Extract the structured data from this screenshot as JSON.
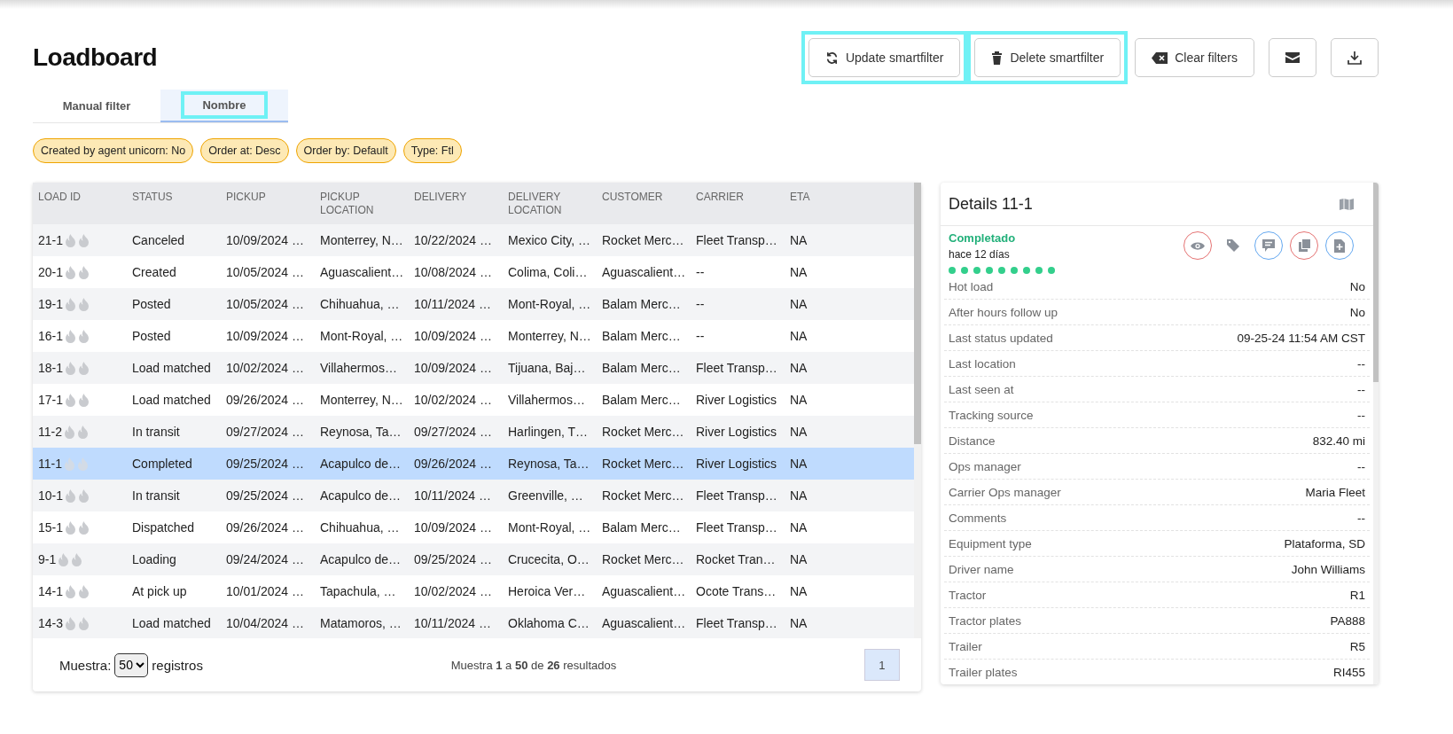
{
  "page": {
    "title": "Loadboard"
  },
  "toolbar": [
    {
      "label": "Update smartfilter",
      "highlighted": true
    },
    {
      "label": "Delete smartfilter",
      "highlighted": true
    },
    {
      "label": "Clear filters",
      "highlighted": false
    },
    {
      "highlighted": false
    },
    {
      "highlighted": false
    }
  ],
  "tabs": [
    {
      "label": "Manual filter",
      "selected": false,
      "highlighted": false
    },
    {
      "label": "Nombre",
      "selected": true,
      "highlighted": true
    }
  ],
  "filter_chips": [
    "Created by agent unicorn: No",
    "Order at: Desc",
    "Order by: Default",
    "Type: Ftl"
  ],
  "table": {
    "columns": [
      "LOAD ID",
      "STATUS",
      "PICKUP",
      "PICKUP LOCATION",
      "DELIVERY",
      "DELIVERY LOCATION",
      "CUSTOMER",
      "CARRIER",
      "ETA"
    ],
    "rows": [
      {
        "selected": false,
        "cells": [
          "21-1",
          "Canceled",
          "10/09/2024 …",
          "Monterrey, N…",
          "10/22/2024 …",
          "Mexico City, …",
          "Rocket Merc…",
          "Fleet Transp…",
          "NA"
        ]
      },
      {
        "selected": false,
        "cells": [
          "20-1",
          "Created",
          "10/05/2024 …",
          "Aguascalient…",
          "10/08/2024 …",
          "Colima, Coli…",
          "Aguascalient…",
          "--",
          "NA"
        ]
      },
      {
        "selected": false,
        "cells": [
          "19-1",
          "Posted",
          "10/05/2024 …",
          "Chihuahua, …",
          "10/11/2024 …",
          "Mont-Royal, …",
          "Balam Merc…",
          "--",
          "NA"
        ]
      },
      {
        "selected": false,
        "cells": [
          "16-1",
          "Posted",
          "10/09/2024 …",
          "Mont-Royal, …",
          "10/09/2024 …",
          "Monterrey, N…",
          "Balam Merc…",
          "--",
          "NA"
        ]
      },
      {
        "selected": false,
        "cells": [
          "18-1",
          "Load matched",
          "10/02/2024 …",
          "Villahermos…",
          "10/09/2024 …",
          "Tijuana, Baj…",
          "Balam Merc…",
          "Fleet Transp…",
          "NA"
        ]
      },
      {
        "selected": false,
        "cells": [
          "17-1",
          "Load matched",
          "09/26/2024 …",
          "Monterrey, N…",
          "10/02/2024 …",
          "Villahermos…",
          "Balam Merc…",
          "River Logistics",
          "NA"
        ]
      },
      {
        "selected": false,
        "cells": [
          "11-2",
          "In transit",
          "09/27/2024 …",
          "Reynosa, Ta…",
          "09/27/2024 …",
          "Harlingen, T…",
          "Rocket Merc…",
          "River Logistics",
          "NA"
        ]
      },
      {
        "selected": true,
        "cells": [
          "11-1",
          "Completed",
          "09/25/2024 …",
          "Acapulco de…",
          "09/26/2024 …",
          "Reynosa, Ta…",
          "Rocket Merc…",
          "River Logistics",
          "NA"
        ]
      },
      {
        "selected": false,
        "cells": [
          "10-1",
          "In transit",
          "09/25/2024 …",
          "Acapulco de…",
          "10/11/2024 …",
          "Greenville, …",
          "Rocket Merc…",
          "Fleet Transp…",
          "NA"
        ]
      },
      {
        "selected": false,
        "cells": [
          "15-1",
          "Dispatched",
          "09/26/2024 …",
          "Chihuahua, …",
          "10/09/2024 …",
          "Mont-Royal, …",
          "Balam Merc…",
          "Fleet Transp…",
          "NA"
        ]
      },
      {
        "selected": false,
        "cells": [
          "9-1",
          "Loading",
          "09/24/2024 …",
          "Acapulco de…",
          "09/25/2024 …",
          "Crucecita, O…",
          "Rocket Merc…",
          "Rocket Tran…",
          "NA"
        ]
      },
      {
        "selected": false,
        "cells": [
          "14-1",
          "At pick up",
          "10/01/2024 …",
          "Tapachula, …",
          "10/02/2024 …",
          "Heroica Ver…",
          "Aguascalient…",
          "Ocote Trans…",
          "NA"
        ]
      },
      {
        "selected": false,
        "cells": [
          "14-3",
          "Load matched",
          "10/04/2024 …",
          "Matamoros, …",
          "10/11/2024 …",
          "Oklahoma C…",
          "Aguascalient…",
          "Fleet Transp…",
          "NA"
        ]
      }
    ],
    "footer": {
      "show_label": "Muestra:",
      "page_size": "50",
      "records_label": "registros",
      "summary": "Muestra **1** a **50** de **26** resultados",
      "pages": [
        {
          "label": "1",
          "selected": true
        }
      ]
    }
  },
  "details": {
    "title": "Details 11-1",
    "status": "Completado",
    "age": "hace 12 días",
    "steps": [
      {
        "done": true
      },
      {
        "done": true
      },
      {
        "done": true
      },
      {
        "done": true
      },
      {
        "done": true
      },
      {
        "done": true
      },
      {
        "done": true
      },
      {
        "done": true
      },
      {
        "done": true
      }
    ],
    "actions": [
      {
        "kind": "ring",
        "color": "#e57373"
      },
      {
        "kind": "plain"
      },
      {
        "kind": "ring",
        "color": "#64a8f0"
      },
      {
        "kind": "ring",
        "color": "#e57373"
      },
      {
        "kind": "ring",
        "color": "#64a8f0"
      }
    ],
    "fields": [
      {
        "label": "Hot load",
        "value": "No"
      },
      {
        "label": "After hours follow up",
        "value": "No"
      },
      {
        "label": "Last status updated",
        "value": "09-25-24 11:54 AM CST"
      },
      {
        "label": "Last location",
        "value": "--"
      },
      {
        "label": "Last seen at",
        "value": "--"
      },
      {
        "label": "Tracking source",
        "value": "--"
      },
      {
        "label": "Distance",
        "value": "832.40 mi"
      },
      {
        "label": "Ops manager",
        "value": "--"
      },
      {
        "label": "Carrier Ops manager",
        "value": "Maria Fleet"
      },
      {
        "label": "Comments",
        "value": "--"
      },
      {
        "label": "Equipment type",
        "value": "Plataforma, SD"
      },
      {
        "label": "Driver name",
        "value": "John Williams"
      },
      {
        "label": "Tractor",
        "value": "R1"
      },
      {
        "label": "Tractor plates",
        "value": "PA888"
      },
      {
        "label": "Trailer",
        "value": "R5"
      },
      {
        "label": "Trailer plates",
        "value": "RI455"
      }
    ]
  }
}
